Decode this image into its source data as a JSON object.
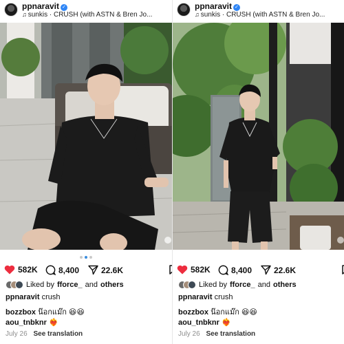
{
  "posts": [
    {
      "username": "ppnaravit",
      "music": "sunkis · CRUSH (with ASTN & Bren Jo...",
      "likes": "582K",
      "comments": "8,400",
      "shares": "22.6K",
      "liked_by_prefix": "Liked by",
      "liked_by_user": "fforce_",
      "liked_by_and": "and",
      "liked_by_others": "others",
      "caption_user": "ppnaravit",
      "caption_text": "crush",
      "comment1_user": "bozzbox",
      "comment1_text": "น๊อกแม๊ก 😆😆",
      "comment2_user": "aou_tnbknr",
      "comment2_text": "❤️‍🔥",
      "date": "July 26",
      "translate": "See translation",
      "carousel_count": 3,
      "carousel_active": 1
    },
    {
      "username": "ppnaravit",
      "music": "sunkis · CRUSH (with ASTN & Bren Jo...",
      "likes": "582K",
      "comments": "8,400",
      "shares": "22.6K",
      "liked_by_prefix": "Liked by",
      "liked_by_user": "fforce_",
      "liked_by_and": "and",
      "liked_by_others": "others",
      "caption_user": "ppnaravit",
      "caption_text": "crush",
      "comment1_user": "bozzbox",
      "comment1_text": "น๊อกแม๊ก 😆😆",
      "comment2_user": "aou_tnbknr",
      "comment2_text": "❤️‍🔥",
      "date": "July 26",
      "translate": "See translation",
      "carousel_count": 0,
      "carousel_active": 0
    }
  ],
  "colors": {
    "like_red": "#ed2d3f",
    "verified_blue": "#2f86f6",
    "dot_active": "#3a8dde",
    "muted_text": "#8e8e8e"
  },
  "icons": {
    "heart": "heart-icon",
    "comment": "comment-icon",
    "share": "share-icon",
    "save": "bookmark-icon",
    "music": "music-note-icon",
    "verified": "verified-badge-icon"
  }
}
